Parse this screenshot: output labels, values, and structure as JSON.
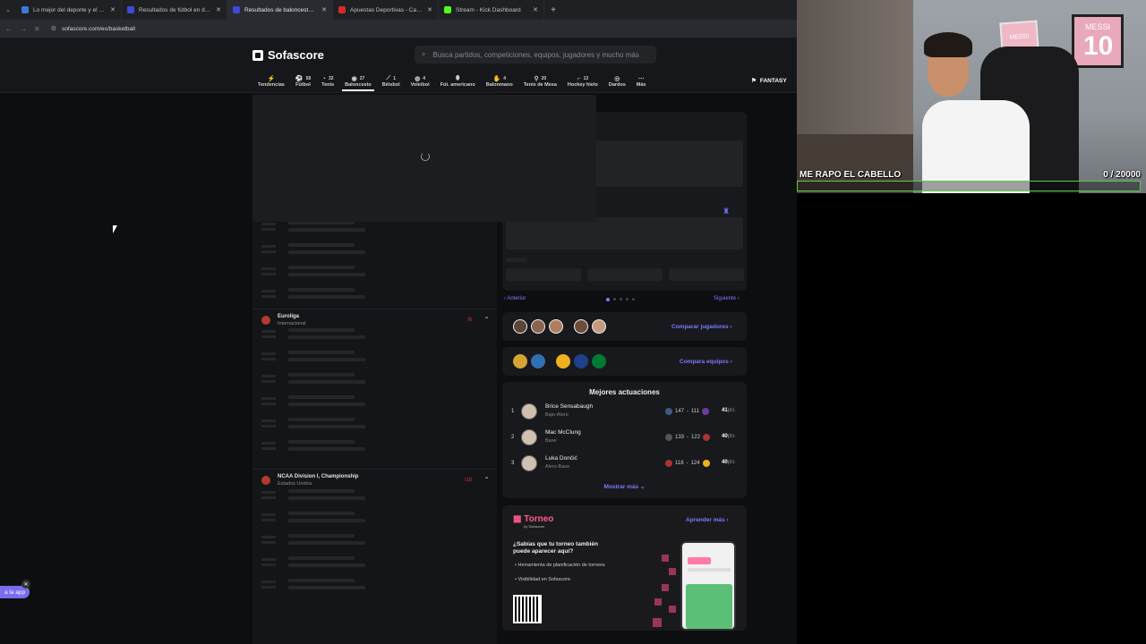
{
  "browser": {
    "tabs": [
      {
        "label": "Lo mejor del deporte y el entre",
        "favicon_color": "#3a7bd5",
        "active": false
      },
      {
        "label": "Resultados de fútbol en directo",
        "favicon_color": "#3c4bd6",
        "active": false
      },
      {
        "label": "Resultados de baloncesto en di",
        "favicon_color": "#3c4bd6",
        "active": true
      },
      {
        "label": "Apuestas Deportivas - Casa de",
        "favicon_color": "#d62a2a",
        "active": false
      },
      {
        "label": "Stream - Kick Dashboard",
        "favicon_color": "#53fc18",
        "active": false
      }
    ],
    "url": "sofascore.com/es/basketball"
  },
  "site": {
    "logo": "Sofascore",
    "search_placeholder": "Busca partidos, competiciones, equipos, jugadores y mucho más",
    "sports": [
      {
        "label": "Tendencias",
        "count": "",
        "icon": "flame-icon"
      },
      {
        "label": "Fútbol",
        "count": "58",
        "icon": "football-icon"
      },
      {
        "label": "Tenis",
        "count": "32",
        "icon": "tennis-icon"
      },
      {
        "label": "Baloncesto",
        "count": "27",
        "icon": "basketball-icon",
        "active": true
      },
      {
        "label": "Béisbol",
        "count": "1",
        "icon": "baseball-icon"
      },
      {
        "label": "Voleibol",
        "count": "4",
        "icon": "volleyball-icon"
      },
      {
        "label": "Fút. americano",
        "count": "",
        "icon": "american-football-icon"
      },
      {
        "label": "Balonmano",
        "count": "4",
        "icon": "handball-icon"
      },
      {
        "label": "Tenis de Mesa",
        "count": "20",
        "icon": "table-tennis-icon"
      },
      {
        "label": "Hockey hielo",
        "count": "13",
        "icon": "hockey-icon"
      },
      {
        "label": "Dardos",
        "count": "",
        "icon": "darts-icon"
      },
      {
        "label": "Más",
        "count": "",
        "icon": "more-icon"
      }
    ],
    "fantasy": "FANTASY"
  },
  "leagues": [
    {
      "name": "Euroliga",
      "country": "Internacional",
      "count": "/6"
    },
    {
      "name": "NCAA Division I, Championship",
      "country": "Estados Unidos",
      "count": "/18"
    }
  ],
  "right": {
    "prev": "Anterior",
    "next": "Siguiente",
    "compare_players": "Comparar jugadores",
    "compare_teams": "Compara equipos",
    "best_title": "Mejores actuaciones",
    "best": [
      {
        "rank": "1",
        "name": "Brice Sensabaugh",
        "pos": "Bajo-Alero",
        "score_a": "147",
        "score_b": "111",
        "pts": "41",
        "unit": "pts"
      },
      {
        "rank": "2",
        "name": "Mac McClung",
        "pos": "Base",
        "score_a": "133",
        "score_b": "122",
        "pts": "40",
        "unit": "pts"
      },
      {
        "rank": "3",
        "name": "Luka Dončić",
        "pos": "Alero-Base",
        "score_a": "118",
        "score_b": "124",
        "pts": "40",
        "unit": "pts"
      }
    ],
    "show_more": "Mostrar más",
    "torneo": {
      "logo": "Torneo",
      "by": "by Sofascore",
      "learn": "Aprender más",
      "question": "¿Sabías que tu torneo también puede aparecer aquí?",
      "bullet1": "Herramienta de planificación de torneos",
      "bullet2": "Visibilidad en Sofascore"
    }
  },
  "overlay": {
    "title": "ME RAPO EL CABELLO",
    "count": "0  / 20000",
    "progress": 0.0,
    "poster": "MESSI",
    "poster_num": "10"
  },
  "app_badge": "a la app"
}
